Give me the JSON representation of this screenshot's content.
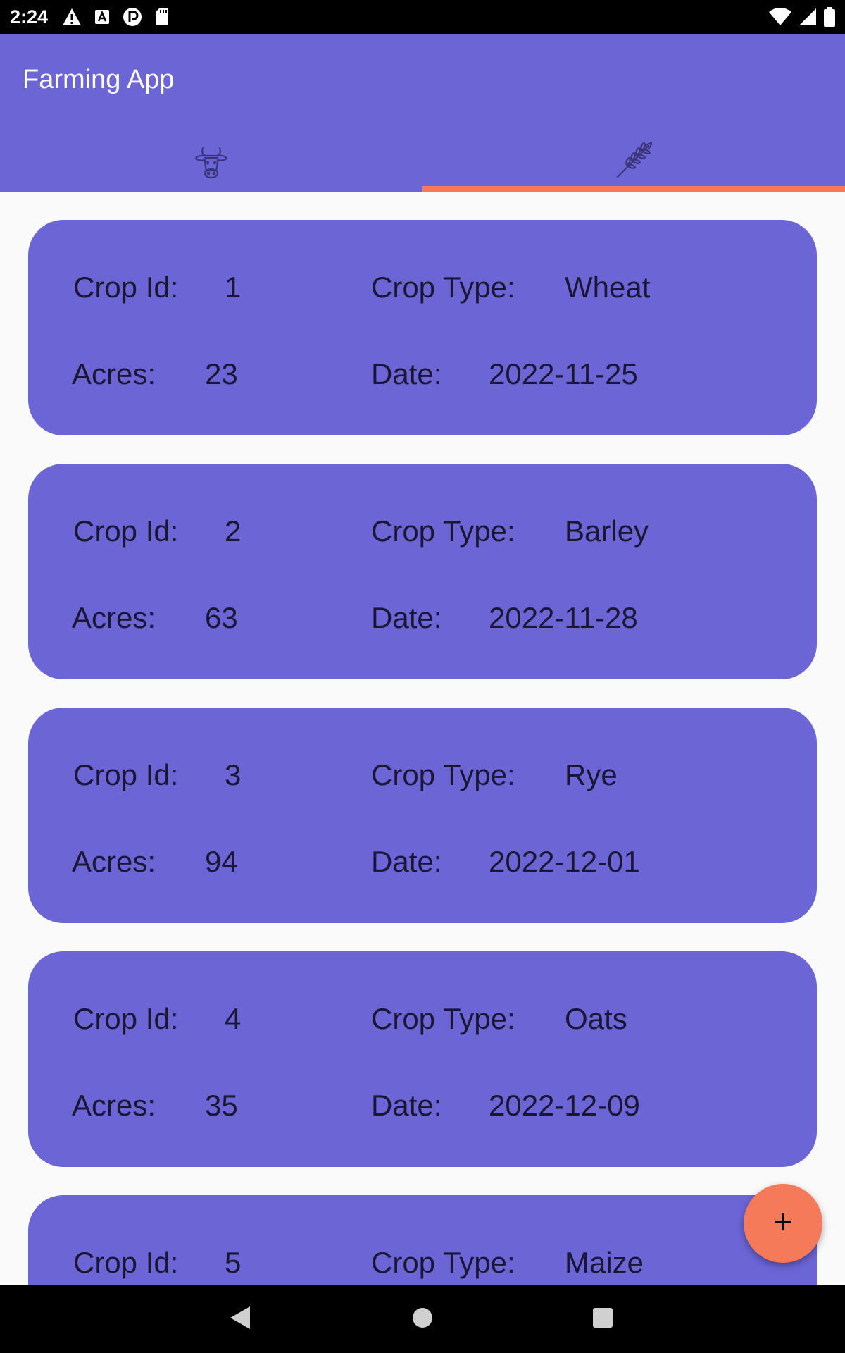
{
  "status_bar": {
    "time": "2:24",
    "left_icons": [
      "warning-icon",
      "text-a-icon",
      "pocket-icon",
      "sd-card-icon"
    ],
    "right_icons": [
      "wifi-icon",
      "signal-icon",
      "battery-icon"
    ]
  },
  "app_bar": {
    "title": "Farming App",
    "tabs": [
      {
        "icon": "cow-icon",
        "active": false
      },
      {
        "icon": "wheat-icon",
        "active": true
      }
    ]
  },
  "labels": {
    "crop_id": "Crop Id:",
    "crop_type": "Crop Type:",
    "acres": "Acres:",
    "date": "Date:"
  },
  "crops": [
    {
      "id": "1",
      "type": "Wheat",
      "acres": "23",
      "date": "2022-11-25"
    },
    {
      "id": "2",
      "type": "Barley",
      "acres": "63",
      "date": "2022-11-28"
    },
    {
      "id": "3",
      "type": "Rye",
      "acres": "94",
      "date": "2022-12-01"
    },
    {
      "id": "4",
      "type": "Oats",
      "acres": "35",
      "date": "2022-12-09"
    },
    {
      "id": "5",
      "type": "Maize"
    }
  ],
  "fab": {
    "icon": "plus-icon"
  },
  "nav": [
    "back-icon",
    "home-icon",
    "recents-icon"
  ],
  "colors": {
    "primary": "#6b65d6",
    "accent": "#f57a5a"
  }
}
